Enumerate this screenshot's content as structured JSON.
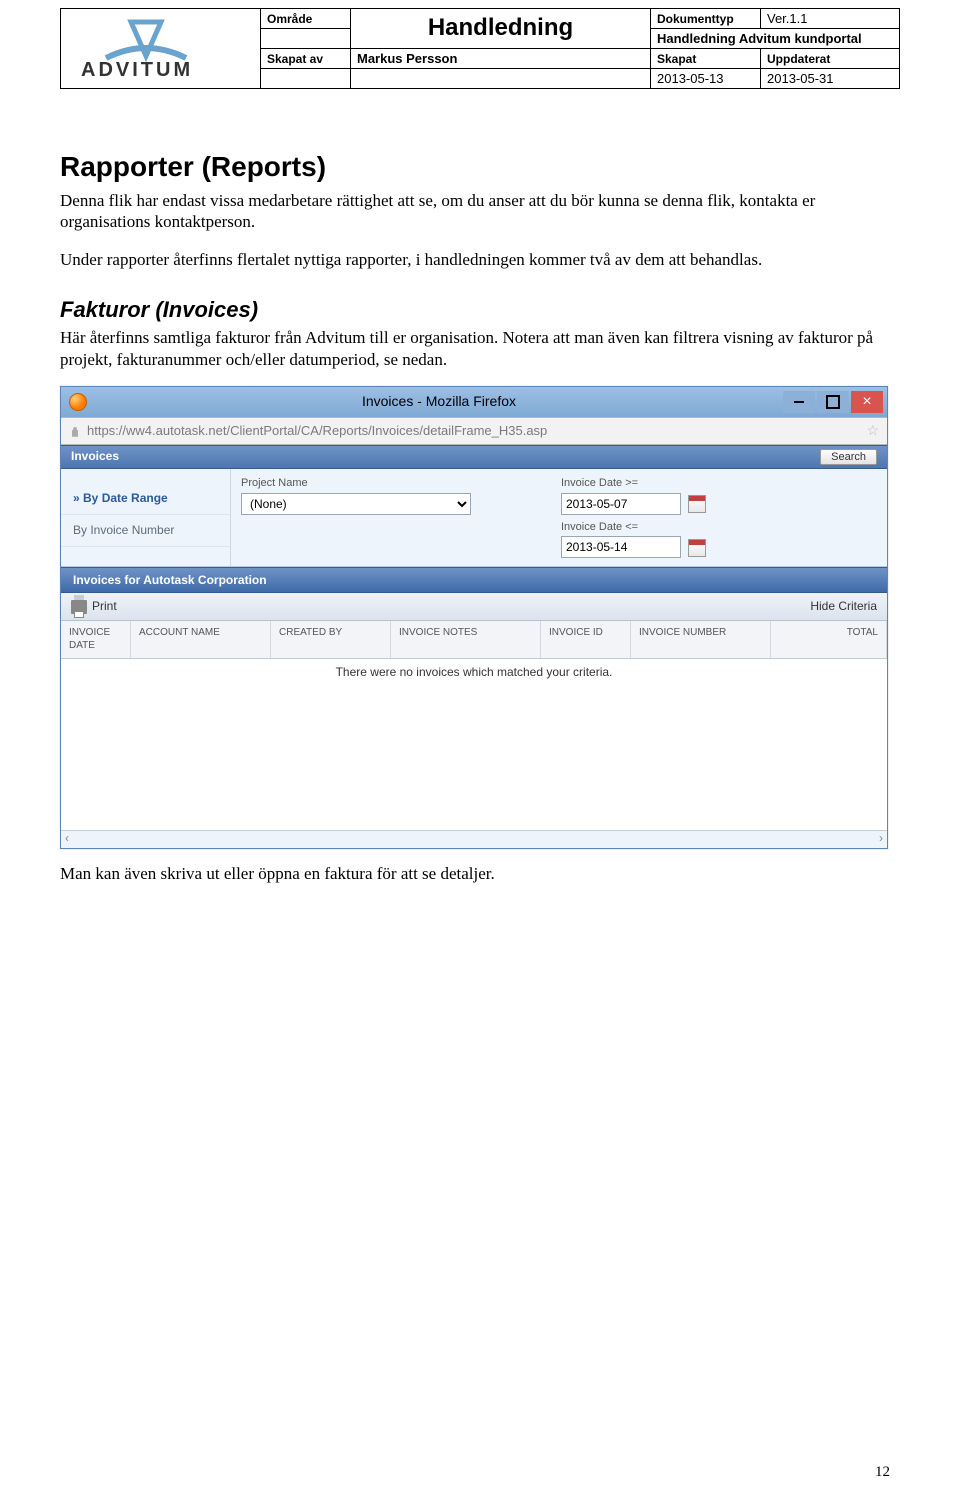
{
  "header": {
    "omrade_label": "Område",
    "dokumenttyp_label": "Dokumenttyp",
    "version": "Ver.1.1",
    "subtitle": "Handledning Advitum kundportal",
    "main_title": "Handledning",
    "skapat_av_label": "Skapat av",
    "skapat_av": "Markus Persson",
    "skapat_label": "Skapat",
    "skapat_date": "2013-05-13",
    "uppdaterat_label": "Uppdaterat",
    "uppdaterat_date": "2013-05-31",
    "logo_text": "ADVITUM"
  },
  "body": {
    "h1": "Rapporter (Reports)",
    "p1": "Denna flik har endast vissa medarbetare rättighet att se, om du anser att du bör kunna se denna flik, kontakta er organisations kontaktperson.",
    "p2": "Under rapporter återfinns flertalet nyttiga rapporter, i handledningen kommer två av dem att behandlas.",
    "h2": "Fakturor (Invoices)",
    "p3": "Här återfinns samtliga fakturor från Advitum till er organisation. Notera att man även kan filtrera visning av fakturor på projekt, fakturanummer och/eller datumperiod, se nedan.",
    "p4": "Man kan även skriva ut eller öppna en faktura för att se detaljer."
  },
  "shot": {
    "window_title": "Invoices - Mozilla Firefox",
    "url": "https://ww4.autotask.net/ClientPortal/CA/Reports/Invoices/detailFrame_H35.asp",
    "panel_title": "Invoices",
    "search_btn": "Search",
    "side_active": "By Date Range",
    "side_other": "By Invoice Number",
    "project_label": "Project Name",
    "project_value": "(None)",
    "date_ge_label": "Invoice Date >=",
    "date_ge_value": "2013-05-07",
    "date_le_label": "Invoice Date <=",
    "date_le_value": "2013-05-14",
    "section2": "Invoices for Autotask Corporation",
    "print": "Print",
    "hide_criteria": "Hide Criteria",
    "col_date": "INVOICE DATE",
    "col_acc": "ACCOUNT NAME",
    "col_cb": "CREATED BY",
    "col_notes": "INVOICE NOTES",
    "col_id": "INVOICE ID",
    "col_num": "INVOICE NUMBER",
    "col_total": "TOTAL",
    "empty_msg": "There were no invoices which matched your criteria."
  },
  "page_number": "12"
}
